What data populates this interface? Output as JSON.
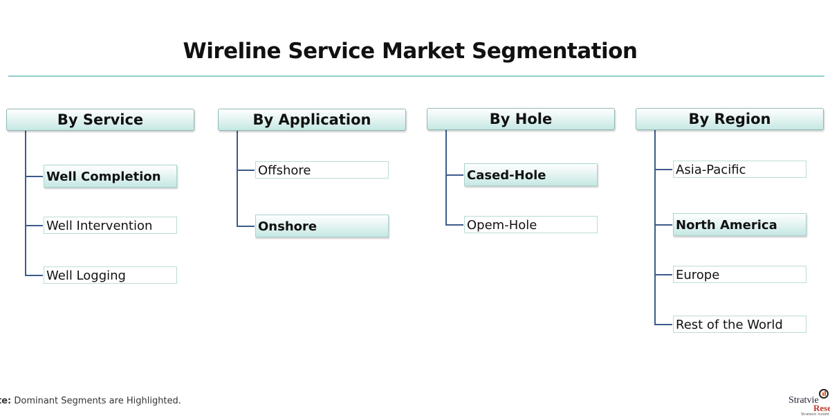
{
  "title": "Wireline Service Market Segmentation",
  "columns": [
    {
      "header": "By Service",
      "items": [
        {
          "label": "Well Completion",
          "highlighted": true
        },
        {
          "label": "Well Intervention",
          "highlighted": false
        },
        {
          "label": "Well Logging",
          "highlighted": false
        }
      ]
    },
    {
      "header": "By Application",
      "items": [
        {
          "label": "Offshore",
          "highlighted": false
        },
        {
          "label": "Onshore",
          "highlighted": true
        }
      ]
    },
    {
      "header": "By Hole",
      "items": [
        {
          "label": "Cased-Hole",
          "highlighted": true
        },
        {
          "label": "Opem-Hole",
          "highlighted": false
        }
      ]
    },
    {
      "header": "By Region",
      "items": [
        {
          "label": "Asia-Pacific",
          "highlighted": false
        },
        {
          "label": "North America",
          "highlighted": true
        },
        {
          "label": "Europe",
          "highlighted": false
        },
        {
          "label": "Rest of the World",
          "highlighted": false
        }
      ]
    }
  ],
  "note": {
    "prefix": "te:",
    "text": " Dominant Segments are Highlighted."
  },
  "logo": {
    "name": "Stratview",
    "sub": "Rese",
    "tagline": "Strategic Insight"
  },
  "colors": {
    "accent": "#8fd0c9",
    "connector": "#3b5a8a",
    "highlight": "#c6e8e4"
  }
}
